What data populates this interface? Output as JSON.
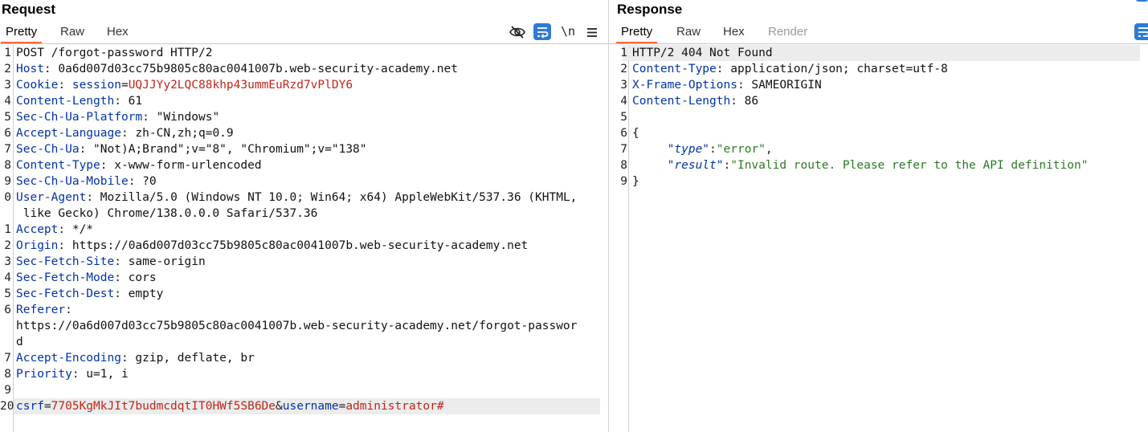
{
  "request": {
    "title": "Request",
    "tabs": [
      "Pretty",
      "Raw",
      "Hex"
    ],
    "icons": [
      "eye-off-icon",
      "wrap-lines-icon",
      "newline-toggle-icon",
      "menu-icon"
    ],
    "newline_label": "\\n",
    "lines": [
      {
        "n": "1",
        "text": "POST /forgot-password HTTP/2"
      },
      {
        "n": "2",
        "key": "Host",
        "value": "0a6d007d03cc75b9805c80ac0041007b.web-security-academy.net"
      },
      {
        "n": "3",
        "key": "Cookie",
        "cookie_name": "session",
        "cookie_value": "UQJJYy2LQC88khp43ummEuRzd7vPlDY6"
      },
      {
        "n": "4",
        "key": "Content-Length",
        "value": "61"
      },
      {
        "n": "5",
        "key": "Sec-Ch-Ua-Platform",
        "value": "\"Windows\""
      },
      {
        "n": "6",
        "key": "Accept-Language",
        "value": "zh-CN,zh;q=0.9"
      },
      {
        "n": "7",
        "key": "Sec-Ch-Ua",
        "value": "\"Not)A;Brand\";v=\"8\", \"Chromium\";v=\"138\""
      },
      {
        "n": "8",
        "key": "Content-Type",
        "value": "x-www-form-urlencoded"
      },
      {
        "n": "9",
        "key": "Sec-Ch-Ua-Mobile",
        "value": "?0"
      },
      {
        "n": "0",
        "key": "User-Agent",
        "value": "Mozilla/5.0 (Windows NT 10.0; Win64; x64) AppleWebKit/537.36 (KHTML,"
      },
      {
        "n": "",
        "value": " like Gecko) Chrome/138.0.0.0 Safari/537.36"
      },
      {
        "n": "1",
        "key": "Accept",
        "value": "*/*"
      },
      {
        "n": "2",
        "key": "Origin",
        "value": "https://0a6d007d03cc75b9805c80ac0041007b.web-security-academy.net"
      },
      {
        "n": "3",
        "key": "Sec-Fetch-Site",
        "value": "same-origin"
      },
      {
        "n": "4",
        "key": "Sec-Fetch-Mode",
        "value": "cors"
      },
      {
        "n": "5",
        "key": "Sec-Fetch-Dest",
        "value": "empty"
      },
      {
        "n": "6",
        "key": "Referer",
        "value": ""
      },
      {
        "n": "",
        "value": "https://0a6d007d03cc75b9805c80ac0041007b.web-security-academy.net/forgot-passwor"
      },
      {
        "n": "",
        "value": "d"
      },
      {
        "n": "7",
        "key": "Accept-Encoding",
        "value": "gzip, deflate, br"
      },
      {
        "n": "8",
        "key": "Priority",
        "value": "u=1, i"
      },
      {
        "n": "9",
        "text": ""
      },
      {
        "n": "20",
        "body": [
          {
            "name": "csrf",
            "value": "7705KgMkJIt7budmcdqtIT0HWf5SB6De"
          },
          {
            "name": "username",
            "value": "administrator#"
          }
        ]
      }
    ]
  },
  "response": {
    "title": "Response",
    "tabs": [
      "Pretty",
      "Raw",
      "Hex",
      "Render"
    ],
    "lines": [
      {
        "n": "1",
        "text": "HTTP/2 404 Not Found"
      },
      {
        "n": "2",
        "key": "Content-Type",
        "value": "application/json; charset=utf-8"
      },
      {
        "n": "3",
        "key": "X-Frame-Options",
        "value": "SAMEORIGIN"
      },
      {
        "n": "4",
        "key": "Content-Length",
        "value": "86"
      },
      {
        "n": "5",
        "text": ""
      },
      {
        "n": "6",
        "text": "{"
      },
      {
        "n": "7",
        "json_key": "\"type\"",
        "json_value": "\"error\"",
        "trail": ","
      },
      {
        "n": "8",
        "json_key": "\"result\"",
        "json_value": "\"Invalid route. Please refer to the API definition\"",
        "trail": ""
      },
      {
        "n": "9",
        "text": "}"
      }
    ]
  },
  "colors": {
    "header_key": "#0033aa",
    "cookie_value": "#c0261b",
    "json_string": "#2b7a22",
    "active_tab_underline": "#ff6633",
    "icon_button": "#2e7bd6"
  }
}
